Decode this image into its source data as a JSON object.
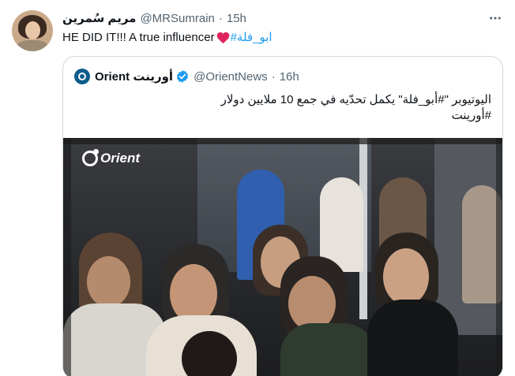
{
  "tweet": {
    "author_name": "مريم سُمرين",
    "handle": "@MRSumrain",
    "separator": "·",
    "time": "15h",
    "more_icon": "more-horizontal-icon",
    "text": "HE DID IT!!! A true influencer",
    "hashtag": "#ابو_فلة"
  },
  "quote": {
    "name": "Orient أورينت",
    "handle": "@OrientNews",
    "separator": "·",
    "time": "16h",
    "line1": "اليوتيوبر \"#أبو_فلة\" يكمل تحدّيه في جمع 10 ملايين دولار",
    "line2": "#أورينت",
    "watermark": "Orient"
  },
  "colors": {
    "link": "#1d9bf0",
    "secondary_text": "#536471",
    "heart": "#f91880",
    "verified": "#1d9bf0",
    "border": "#cfd9de"
  }
}
